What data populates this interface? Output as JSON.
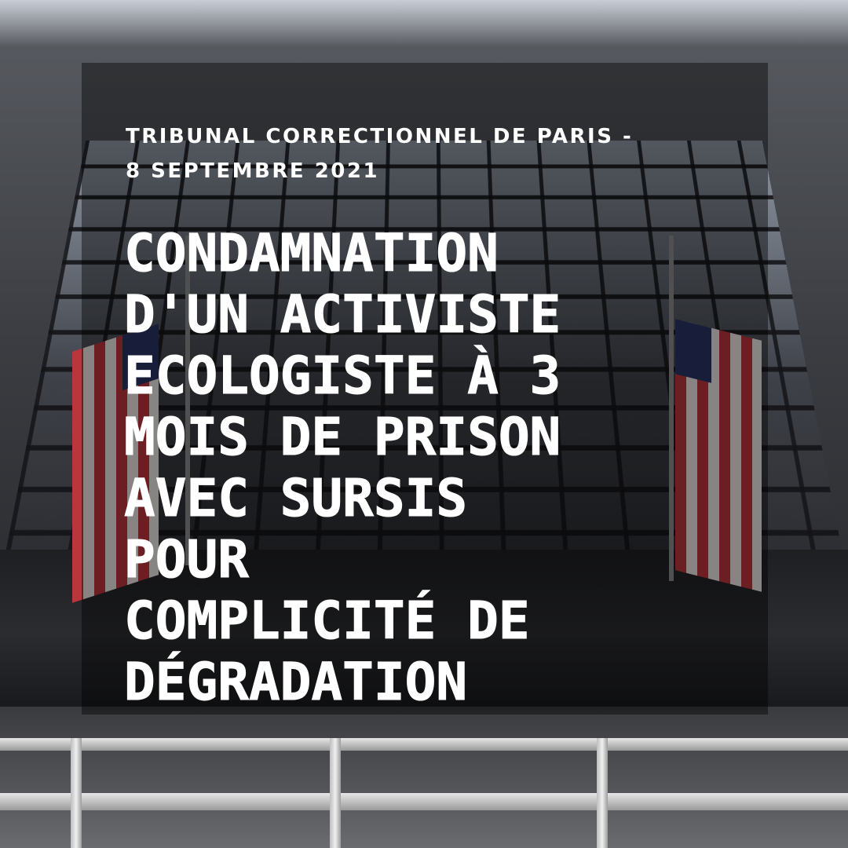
{
  "post": {
    "subtitle_line1": "TRIBUNAL CORRECTIONNEL DE PARIS -",
    "subtitle_line2": "8 SEPTEMBRE 2021",
    "headline_lines": [
      "CONDAMNATION",
      "D'UN ACTIVISTE",
      "ECOLOGISTE À 3",
      "MOIS DE PRISON",
      "AVEC SURSIS",
      "POUR",
      "COMPLICITÉ DE",
      "DÉGRADATION"
    ]
  },
  "colors": {
    "text": "#ffffff",
    "overlay": "rgba(0,0,0,0.42)",
    "flag_red": "#b8363c",
    "flag_blue": "#2a3564"
  }
}
